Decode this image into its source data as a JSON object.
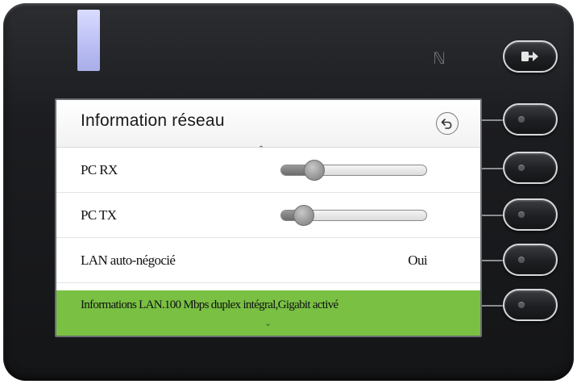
{
  "screen": {
    "title": "Information réseau",
    "rows": [
      {
        "label": "PC RX",
        "type": "slider",
        "level": 0.2
      },
      {
        "label": "PC TX",
        "type": "slider",
        "level": 0.12
      },
      {
        "label": "LAN auto-négocié",
        "type": "value",
        "value": "Oui"
      }
    ],
    "info_bar": {
      "text": "Informations LAN.100 Mbps duplex intégral,Gigabit activé"
    },
    "accent_color": "#79c043"
  },
  "icons": {
    "back": "back-arrow-icon",
    "logout": "logout-icon",
    "nfc": "nfc-icon",
    "scroll_up": "chevron-up-icon",
    "scroll_down": "chevron-down-icon"
  }
}
